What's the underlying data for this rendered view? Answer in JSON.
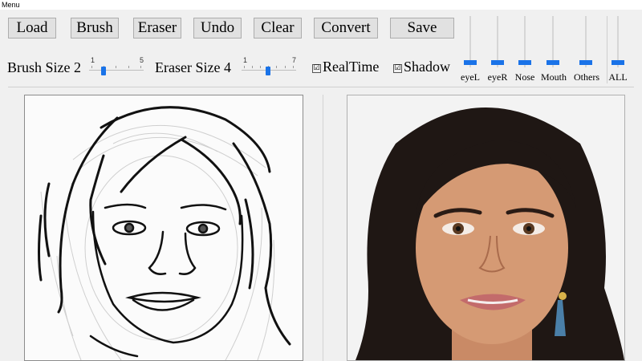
{
  "menu": {
    "label": "Menu"
  },
  "toolbar": {
    "load": "Load",
    "brush": "Brush",
    "eraser": "Eraser",
    "undo": "Undo",
    "clear": "Clear",
    "convert": "Convert",
    "save": "Save"
  },
  "brush_size": {
    "label": "Brush Size 2",
    "min": "1",
    "max": "5",
    "value": 2
  },
  "eraser_size": {
    "label": "Eraser Size 4",
    "min": "1",
    "max": "7",
    "value": 4
  },
  "options": {
    "realtime": {
      "label": "RealTime",
      "checked": true,
      "mark": "☑"
    },
    "shadow": {
      "label": "Shadow",
      "checked": true,
      "mark": "☑"
    }
  },
  "feature_sliders": [
    {
      "label": "eyeL"
    },
    {
      "label": "eyeR"
    },
    {
      "label": "Nose"
    },
    {
      "label": "Mouth"
    },
    {
      "label": "Others"
    },
    {
      "label": "ALL"
    }
  ],
  "colors": {
    "accent": "#1a73e8",
    "button_bg": "#e1e1e1"
  },
  "canvas": {
    "sketch": "face-sketch-drawing",
    "result": "generated-face-photo"
  }
}
